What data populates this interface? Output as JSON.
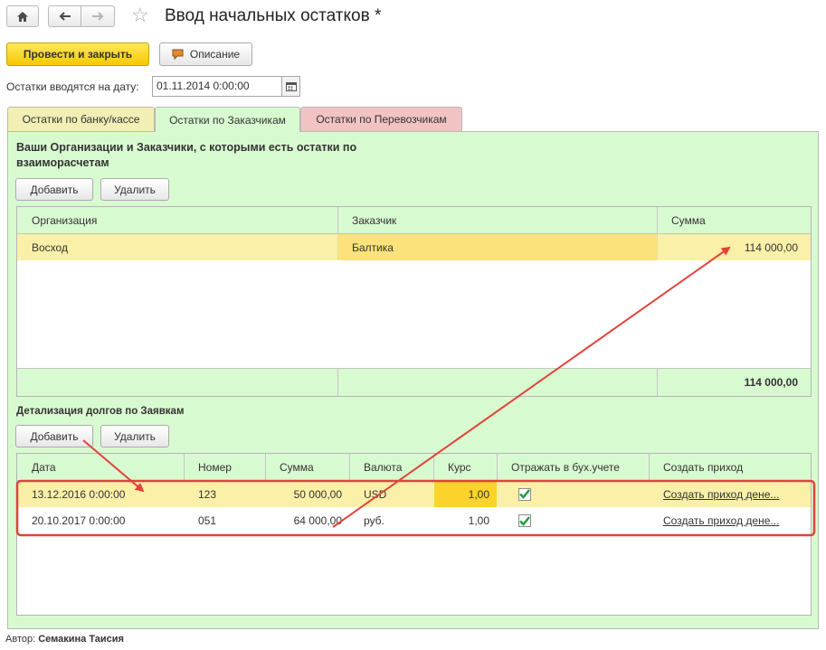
{
  "window": {
    "title": "Ввод начальных остатков *"
  },
  "toolbar": {
    "post_close_label": "Провести и закрыть",
    "description_label": "Описание"
  },
  "date_field": {
    "label": "Остатки вводятся на дату:",
    "value": "01.11.2014  0:00:00"
  },
  "tabs": [
    {
      "label": "Остатки по банку/кассе",
      "color": "#f2efb4"
    },
    {
      "label": "Остатки по Заказчикам",
      "color": "#d8fad0"
    },
    {
      "label": "Остатки по Перевозчикам",
      "color": "#f2c3c3"
    }
  ],
  "customers": {
    "title": "Ваши Организации и Заказчики, с которыми есть остатки по взаиморасчетам",
    "add_label": "Добавить",
    "delete_label": "Удалить",
    "columns": [
      "Организация",
      "Заказчик",
      "Сумма"
    ],
    "rows": [
      {
        "org": "Восход",
        "customer": "Балтика",
        "sum": "114 000,00"
      }
    ],
    "total": "114 000,00"
  },
  "details": {
    "title": "Детализация долгов по Заявкам",
    "add_label": "Добавить",
    "delete_label": "Удалить",
    "columns": [
      "Дата",
      "Номер",
      "Сумма",
      "Валюта",
      "Курс",
      "Отражать в бух.учете",
      "Создать приход"
    ],
    "rows": [
      {
        "date": "13.12.2016 0:00:00",
        "number": "123",
        "sum": "50 000,00",
        "currency": "USD",
        "rate": "1,00",
        "reflect": true,
        "create": "Создать приход дене..."
      },
      {
        "date": "20.10.2017 0:00:00",
        "number": "051",
        "sum": "64 000,00",
        "currency": "руб.",
        "rate": "1,00",
        "reflect": true,
        "create": "Создать приход дене..."
      }
    ]
  },
  "author": {
    "label": "Автор:",
    "name": "Семакина Таисия"
  },
  "colors": {
    "accent_yellow": "#f5c800",
    "highlight_row": "#fbf0a8",
    "annotation_red": "#e0433a",
    "panel_green": "#d8fad0"
  }
}
